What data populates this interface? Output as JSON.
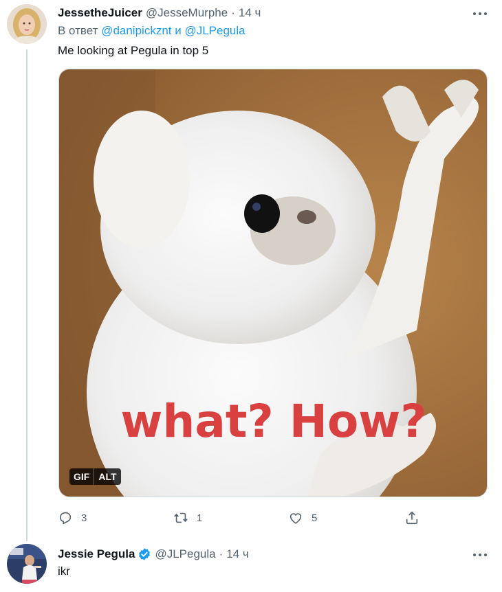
{
  "tweets": [
    {
      "author_name": "JessetheJuicer",
      "handle": "@JesseMurphe",
      "separator": "·",
      "time": "14 ч",
      "reply_prefix": "В ответ",
      "reply_mentions": [
        "@danipickznt",
        "@JLPegula"
      ],
      "reply_joiner": "и",
      "text": "Me looking at Pegula in top 5",
      "media": {
        "caption_text": "what? How?",
        "badges": [
          "GIF",
          "ALT"
        ]
      },
      "actions": {
        "replies": "3",
        "retweets": "1",
        "likes": "5"
      }
    },
    {
      "author_name": "Jessie Pegula",
      "verified": true,
      "handle": "@JLPegula",
      "separator": "·",
      "time": "14 ч",
      "text": "ikr"
    }
  ],
  "colors": {
    "accent": "#1d9bf0",
    "secondary_text": "#536471",
    "primary_text": "#0f1419",
    "thread_line": "#cfd9de",
    "caption_red": "#d8413f"
  },
  "icons": [
    "more-icon",
    "reply-icon",
    "retweet-icon",
    "like-icon",
    "share-icon",
    "verified-icon"
  ]
}
